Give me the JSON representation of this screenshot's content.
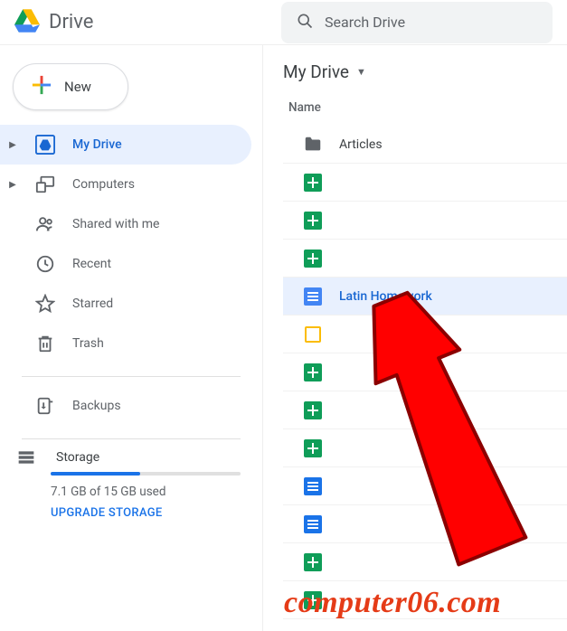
{
  "header": {
    "brand": "Drive",
    "search_placeholder": "Search Drive"
  },
  "sidebar": {
    "new_label": "New",
    "items": [
      {
        "label": "My Drive",
        "has_chevron": true,
        "active": true
      },
      {
        "label": "Computers",
        "has_chevron": true,
        "active": false
      },
      {
        "label": "Shared with me",
        "has_chevron": false,
        "active": false
      },
      {
        "label": "Recent",
        "has_chevron": false,
        "active": false
      },
      {
        "label": "Starred",
        "has_chevron": false,
        "active": false
      },
      {
        "label": "Trash",
        "has_chevron": false,
        "active": false
      }
    ],
    "backups_label": "Backups",
    "storage": {
      "title": "Storage",
      "used_text": "7.1 GB of 15 GB used",
      "upgrade_label": "UPGRADE STORAGE"
    }
  },
  "main": {
    "breadcrumb": "My Drive",
    "column_header": "Name",
    "rows": [
      {
        "type": "folder",
        "label": "Articles",
        "selected": false
      },
      {
        "type": "sheets",
        "label": "",
        "selected": false
      },
      {
        "type": "sheets",
        "label": "",
        "selected": false
      },
      {
        "type": "sheets",
        "label": "",
        "selected": false
      },
      {
        "type": "docs",
        "label": "Latin Homework",
        "selected": true
      },
      {
        "type": "slides",
        "label": "",
        "selected": false
      },
      {
        "type": "sheets",
        "label": "",
        "selected": false
      },
      {
        "type": "sheets",
        "label": "",
        "selected": false
      },
      {
        "type": "sheets",
        "label": "",
        "selected": false
      },
      {
        "type": "docs",
        "label": "",
        "selected": false
      },
      {
        "type": "docs",
        "label": "",
        "selected": false
      },
      {
        "type": "sheets",
        "label": "",
        "selected": false
      },
      {
        "type": "sheets",
        "label": "",
        "selected": false
      }
    ]
  },
  "watermark": "computer06.com"
}
